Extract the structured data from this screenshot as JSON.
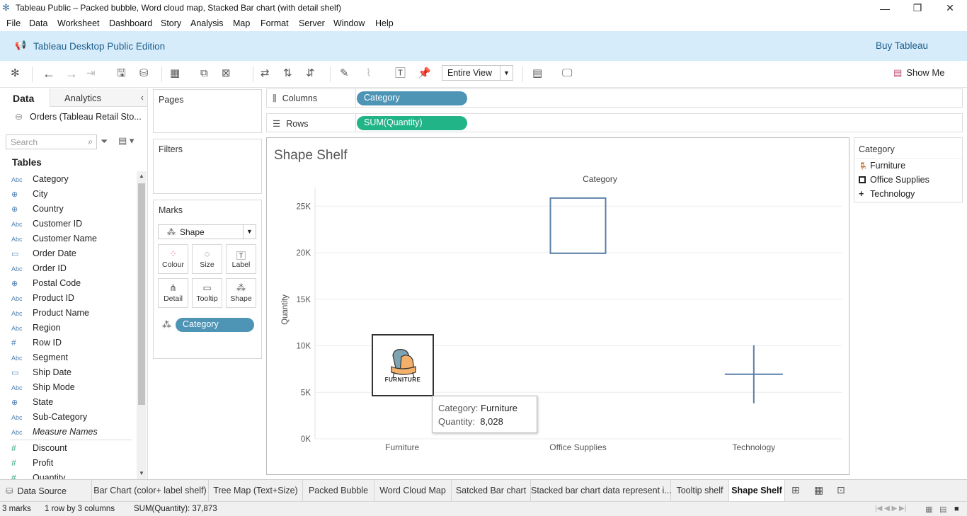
{
  "window": {
    "title": "Tableau Public – Packed bubble, Word cloud map, Stacked Bar chart (with detail shelf)",
    "controls": [
      "—",
      "❐",
      "✕"
    ]
  },
  "menu": [
    "File",
    "Data",
    "Worksheet",
    "Dashboard",
    "Story",
    "Analysis",
    "Map",
    "Format",
    "Server",
    "Window",
    "Help"
  ],
  "banner": {
    "edition": "Tableau Desktop Public Edition",
    "buy": "Buy Tableau"
  },
  "toolbar": {
    "fit": "Entire View",
    "show_me": "Show Me"
  },
  "datapane": {
    "tab_data": "Data",
    "tab_analytics": "Analytics",
    "datasource": "Orders (Tableau Retail Sto...",
    "search_placeholder": "Search",
    "tables_heading": "Tables",
    "dimensions": [
      {
        "icon": "Abc",
        "name": "Category"
      },
      {
        "icon": "globe",
        "name": "City"
      },
      {
        "icon": "globe",
        "name": "Country"
      },
      {
        "icon": "Abc",
        "name": "Customer ID"
      },
      {
        "icon": "Abc",
        "name": "Customer Name"
      },
      {
        "icon": "date",
        "name": "Order Date"
      },
      {
        "icon": "Abc",
        "name": "Order ID"
      },
      {
        "icon": "globe",
        "name": "Postal Code"
      },
      {
        "icon": "Abc",
        "name": "Product ID"
      },
      {
        "icon": "Abc",
        "name": "Product Name"
      },
      {
        "icon": "Abc",
        "name": "Region"
      },
      {
        "icon": "#",
        "name": "Row ID"
      },
      {
        "icon": "Abc",
        "name": "Segment"
      },
      {
        "icon": "date",
        "name": "Ship Date"
      },
      {
        "icon": "Abc",
        "name": "Ship Mode"
      },
      {
        "icon": "globe",
        "name": "State"
      },
      {
        "icon": "Abc",
        "name": "Sub-Category"
      },
      {
        "icon": "Abc",
        "name": "Measure Names"
      }
    ],
    "measures": [
      {
        "icon": "#",
        "name": "Discount"
      },
      {
        "icon": "#",
        "name": "Profit"
      },
      {
        "icon": "#",
        "name": "Quantity"
      }
    ]
  },
  "cards": {
    "pages": "Pages",
    "filters": "Filters",
    "marks": "Marks",
    "mark_type": "Shape",
    "buttons": [
      "Colour",
      "Size",
      "Label",
      "Detail",
      "Tooltip",
      "Shape"
    ],
    "shape_pill": "Category"
  },
  "shelves": {
    "columns_label": "Columns",
    "columns_pill": "Category",
    "rows_label": "Rows",
    "rows_pill": "SUM(Quantity)"
  },
  "view": {
    "title": "Shape Shelf"
  },
  "chart_data": {
    "type": "scatter",
    "title": "Shape Shelf",
    "column_header": "Category",
    "categories": [
      "Furniture",
      "Office Supplies",
      "Technology"
    ],
    "values": [
      8028,
      22906,
      6939
    ],
    "shapes": [
      "furniture-image",
      "open-square",
      "plus"
    ],
    "ylabel": "Quantity",
    "ylim": [
      0,
      27000
    ],
    "yticks": [
      0,
      5000,
      10000,
      15000,
      20000,
      25000
    ],
    "ytick_labels": [
      "0K",
      "5K",
      "10K",
      "15K",
      "20K",
      "25K"
    ],
    "grid": true
  },
  "image_badge": {
    "text": "FURNITURE"
  },
  "tooltip": {
    "k1": "Category:",
    "v1": "Furniture",
    "k2": "Quantity:",
    "v2": "8,028"
  },
  "legend": {
    "title": "Category",
    "items": [
      "Furniture",
      "Office Supplies",
      "Technology"
    ]
  },
  "sheet_tabs": {
    "data_source": "Data Source",
    "tabs": [
      "Bar Chart (color+ label shelf)",
      "Tree Map (Text+Size)",
      "Packed Bubble",
      "Word Cloud Map",
      "Satcked Bar chart",
      "Stacked bar chart data represent i...",
      "Tooltip shelf",
      "Shape Shelf"
    ],
    "active": "Shape Shelf"
  },
  "status": {
    "marks": "3 marks",
    "rows": "1 row  by  3 columns",
    "sum": "SUM(Quantity): 37,873"
  },
  "colors": {
    "accent": "#4e94b5",
    "measure": "#21b486",
    "banner": "#d6ecfb",
    "shape_blue": "#5a7fa8"
  }
}
